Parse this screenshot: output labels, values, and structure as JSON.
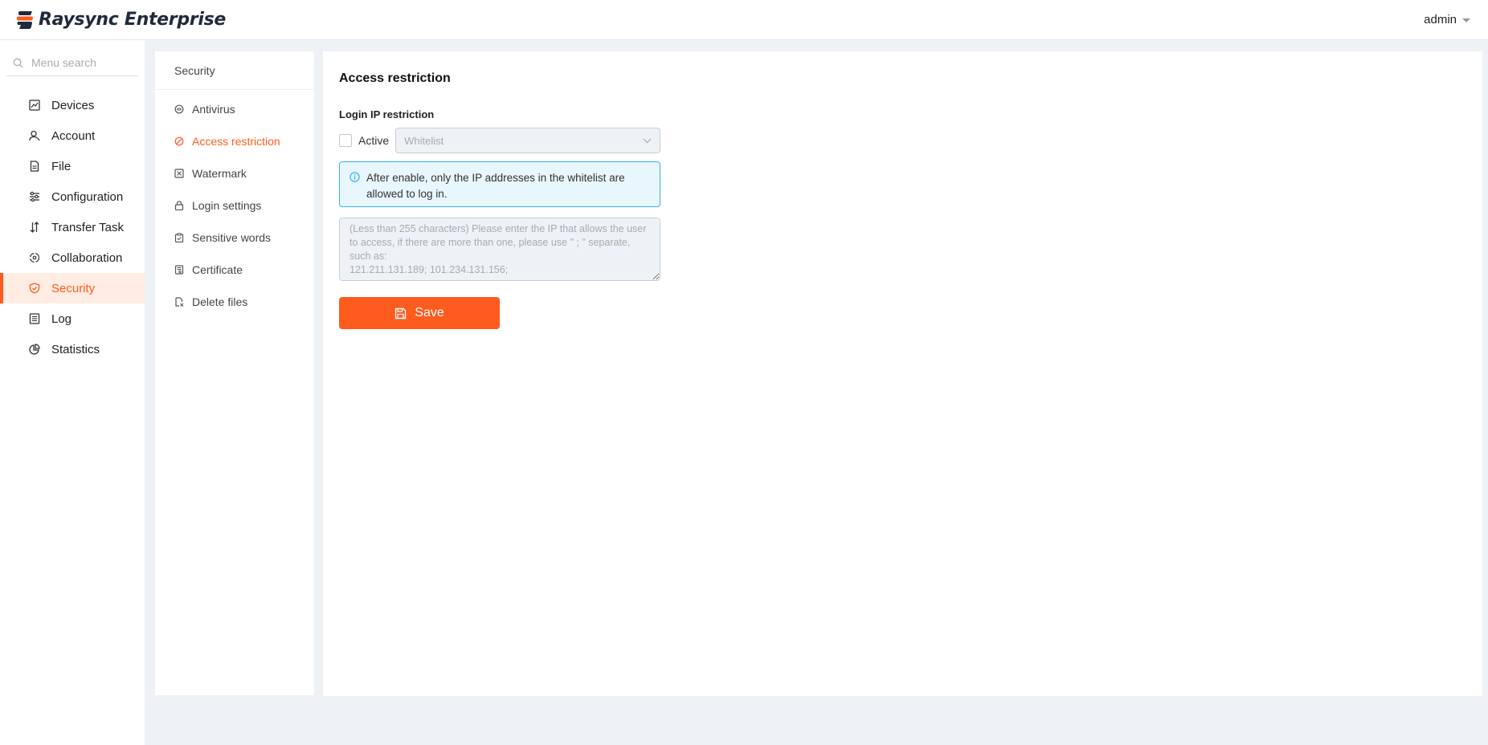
{
  "header": {
    "brand": "Raysync Enterprise",
    "user": "admin"
  },
  "sidebar": {
    "search_placeholder": "Menu search",
    "items": [
      {
        "label": "Devices",
        "icon": "devices-icon"
      },
      {
        "label": "Account",
        "icon": "account-icon"
      },
      {
        "label": "File",
        "icon": "file-icon"
      },
      {
        "label": "Configuration",
        "icon": "configuration-icon"
      },
      {
        "label": "Transfer Task",
        "icon": "transfer-task-icon"
      },
      {
        "label": "Collaboration",
        "icon": "collaboration-icon"
      },
      {
        "label": "Security",
        "icon": "shield-icon",
        "active": true
      },
      {
        "label": "Log",
        "icon": "log-icon"
      },
      {
        "label": "Statistics",
        "icon": "statistics-icon"
      }
    ]
  },
  "submenu": {
    "title": "Security",
    "items": [
      {
        "label": "Antivirus",
        "icon": "antivirus-icon"
      },
      {
        "label": "Access restriction",
        "icon": "access-restriction-icon",
        "active": true
      },
      {
        "label": "Watermark",
        "icon": "watermark-icon"
      },
      {
        "label": "Login settings",
        "icon": "lock-icon"
      },
      {
        "label": "Sensitive words",
        "icon": "clipboard-icon"
      },
      {
        "label": "Certificate",
        "icon": "certificate-icon"
      },
      {
        "label": "Delete files",
        "icon": "delete-files-icon"
      }
    ]
  },
  "main": {
    "title": "Access restriction",
    "section_label": "Login IP restriction",
    "active_label": "Active",
    "active_checked": false,
    "select_value": "Whitelist",
    "alert_text": "After enable, only the IP addresses in the whitelist are allowed to log in.",
    "textarea_placeholder": "(Less than 255 characters) Please enter the IP that allows the user to access, if there are more than one, please use \" ; \" separate, such as:\n121.211.131.189; 101.234.131.156;",
    "save_label": "Save"
  },
  "colors": {
    "accent": "#ff5b1f",
    "active_bg": "#ffece3",
    "info_border": "#34b3f0",
    "info_bg": "#e8f6fe",
    "page_bg": "#eef1f5"
  }
}
